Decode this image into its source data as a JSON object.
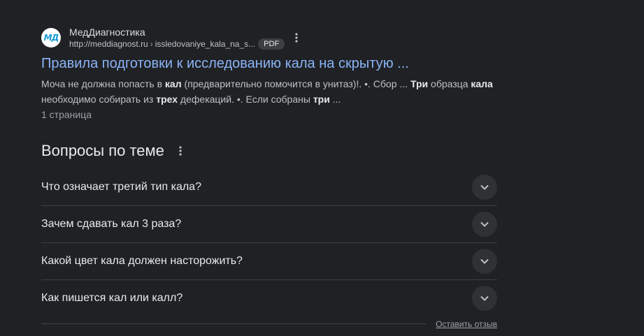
{
  "result": {
    "favicon_text": "МД",
    "site_name": "МедДиагностика",
    "url_host": "http://meddiagnost.ru",
    "url_sep": "›",
    "url_path": "issledovaniye_kala_na_s...",
    "badge": "PDF",
    "title": "Правила подготовки к исследованию кала на скрытую ...",
    "snippet": {
      "s1": "Моча не должна попасть в ",
      "b1": "кал",
      "s2": " (предварительно помочится в унитаз)!. •. Сбор ... ",
      "b2": "Три",
      "s3": " образца ",
      "b3": "кала",
      "s4": " необходимо собирать из ",
      "b4": "трех",
      "s5": " дефекаций. •. Если собраны ",
      "b5": "три",
      "s6": " ..."
    },
    "page_count": "1 страница"
  },
  "related": {
    "title": "Вопросы по теме",
    "questions": [
      "Что означает третий тип кала?",
      "Зачем сдавать кал 3 раза?",
      "Какой цвет кала должен насторожить?",
      "Как пишется кал или калл?"
    ],
    "feedback": "Оставить отзыв"
  },
  "colors": {
    "background": "#202124",
    "link": "#8ab4f8",
    "text": "#bdc1c6",
    "heading": "#e8eaed",
    "divider": "#3c4043",
    "favicon_accent": "#1a9ad6"
  },
  "icons": {
    "more": "more-vert-icon",
    "expand": "chevron-down-icon"
  }
}
